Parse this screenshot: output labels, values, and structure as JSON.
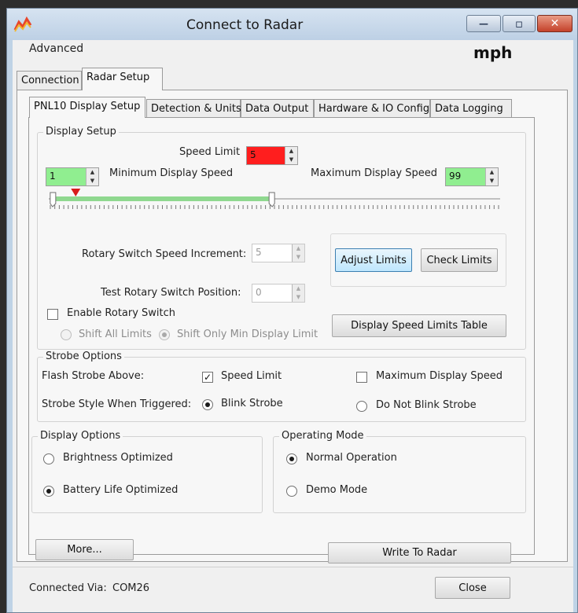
{
  "window": {
    "title": "Connect to Radar",
    "minimize_glyph": "—",
    "maximize_glyph": "▫",
    "close_glyph": "✕"
  },
  "menu": {
    "advanced": "Advanced"
  },
  "units_label": "mph",
  "outer_tabs": [
    "Connection",
    "Radar Setup"
  ],
  "inner_tabs": [
    "PNL10 Display Setup",
    "Detection & Units",
    "Data Output",
    "Hardware & IO Config",
    "Data Logging"
  ],
  "display_setup": {
    "title": "Display Setup",
    "speed_limit_label": "Speed Limit",
    "speed_limit_value": "5",
    "min_label": "Minimum Display Speed",
    "min_value": "1",
    "max_label": "Maximum Display Speed",
    "max_value": "99",
    "slider": {
      "min": 0,
      "max": 200,
      "speed_limit": 5,
      "min_display": 1,
      "max_display": 99
    },
    "rotary_increment_label": "Rotary Switch Speed Increment:",
    "rotary_increment_value": "5",
    "test_position_label": "Test Rotary Switch Position:",
    "test_position_value": "0",
    "adjust_limits": "Adjust Limits",
    "check_limits": "Check Limits",
    "enable_rotary_label": "Enable Rotary Switch",
    "shift_all_label": "Shift All Limits",
    "shift_min_label": "Shift Only Min Display Limit",
    "table_button": "Display Speed Limits Table"
  },
  "strobe": {
    "title": "Strobe Options",
    "flash_label": "Flash Strobe Above:",
    "speed_limit_label": "Speed Limit",
    "max_display_label": "Maximum Display Speed",
    "style_label": "Strobe Style When Triggered:",
    "blink_label": "Blink Strobe",
    "no_blink_label": "Do Not Blink Strobe"
  },
  "display_options": {
    "title": "Display Options",
    "brightness_label": "Brightness Optimized",
    "battery_label": "Battery Life Optimized"
  },
  "operating_mode": {
    "title": "Operating Mode",
    "normal_label": "Normal Operation",
    "demo_label": "Demo Mode"
  },
  "buttons": {
    "more": "More...",
    "write": "Write To Radar",
    "close": "Close"
  },
  "status": {
    "connected_label": "Connected Via:",
    "port": "COM26"
  },
  "colors": {
    "speed_limit_bg": "#ff1e1e",
    "green_field": "#90ee90",
    "slider_track": "#8fd88f"
  }
}
